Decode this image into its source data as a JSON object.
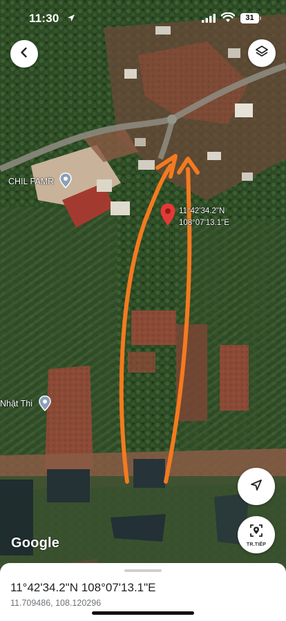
{
  "status_bar": {
    "time": "11:30",
    "battery": "31"
  },
  "map": {
    "places": [
      {
        "name": "CHIL FAMR"
      },
      {
        "name": "Nhật Thi"
      }
    ],
    "dropped_pin": {
      "lat_label": "11°42'34.2\"N",
      "lng_label": "108°07'13.1\"E"
    },
    "attribution": "Google",
    "arrow_color": "#f47a20",
    "pin_color": "#e53935"
  },
  "controls": {
    "back_icon": "chevron-left-icon",
    "layers_icon": "layers-icon",
    "compass_icon": "navigation-arrow-icon",
    "next_label": "TR.TIẾP"
  },
  "bottom_sheet": {
    "title": "11°42'34.2\"N 108°07'13.1\"E",
    "subtitle": "11.709486, 108.120296"
  }
}
